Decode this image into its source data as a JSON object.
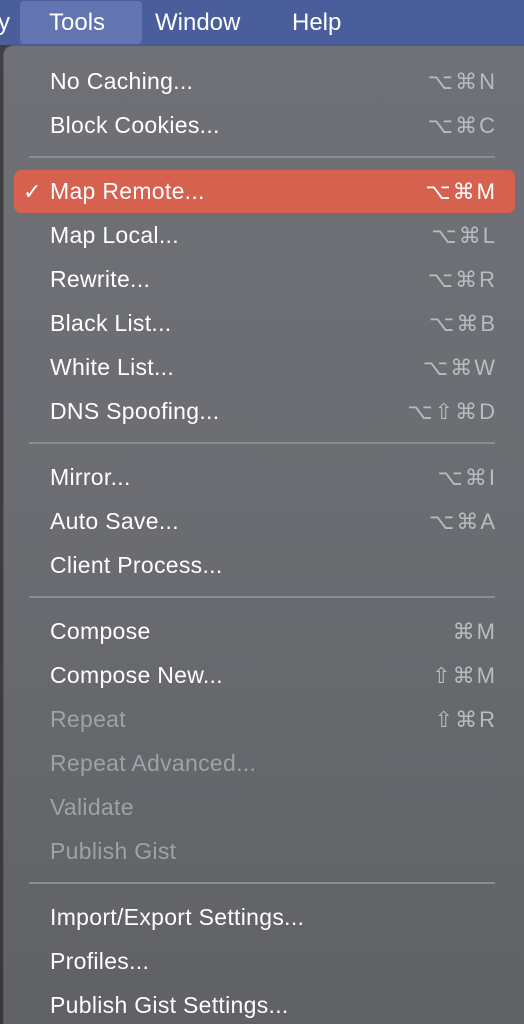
{
  "menubar": {
    "items": [
      {
        "label": "y"
      },
      {
        "label": "Tools"
      },
      {
        "label": "Window"
      },
      {
        "label": "Help"
      }
    ]
  },
  "menu": {
    "check_glyph": "✓",
    "items": [
      {
        "label": "No Caching...",
        "shortcut": "⌥⌘N"
      },
      {
        "label": "Block Cookies...",
        "shortcut": "⌥⌘C"
      },
      {
        "label": "Map Remote...",
        "shortcut": "⌥⌘M",
        "checked": true,
        "highlighted": true
      },
      {
        "label": "Map Local...",
        "shortcut": "⌥⌘L"
      },
      {
        "label": "Rewrite...",
        "shortcut": "⌥⌘R"
      },
      {
        "label": "Black List...",
        "shortcut": "⌥⌘B"
      },
      {
        "label": "White List...",
        "shortcut": "⌥⌘W"
      },
      {
        "label": "DNS Spoofing...",
        "shortcut": "⌥⇧⌘D"
      },
      {
        "label": "Mirror...",
        "shortcut": "⌥⌘I"
      },
      {
        "label": "Auto Save...",
        "shortcut": "⌥⌘A"
      },
      {
        "label": "Client Process..."
      },
      {
        "label": "Compose",
        "shortcut": "⌘M"
      },
      {
        "label": "Compose New...",
        "shortcut": "⇧⌘M"
      },
      {
        "label": "Repeat",
        "shortcut": "⇧⌘R",
        "disabled": true
      },
      {
        "label": "Repeat Advanced...",
        "disabled": true
      },
      {
        "label": "Validate",
        "disabled": true
      },
      {
        "label": "Publish Gist",
        "disabled": true
      },
      {
        "label": "Import/Export Settings..."
      },
      {
        "label": "Profiles..."
      },
      {
        "label": "Publish Gist Settings..."
      }
    ]
  },
  "colors": {
    "menubar": "#4a5e9c",
    "menubar_active": "#6275b0",
    "menu_background": "#6d6f74",
    "highlight": "#d6614f",
    "disabled_text": "#9fa1a6"
  }
}
